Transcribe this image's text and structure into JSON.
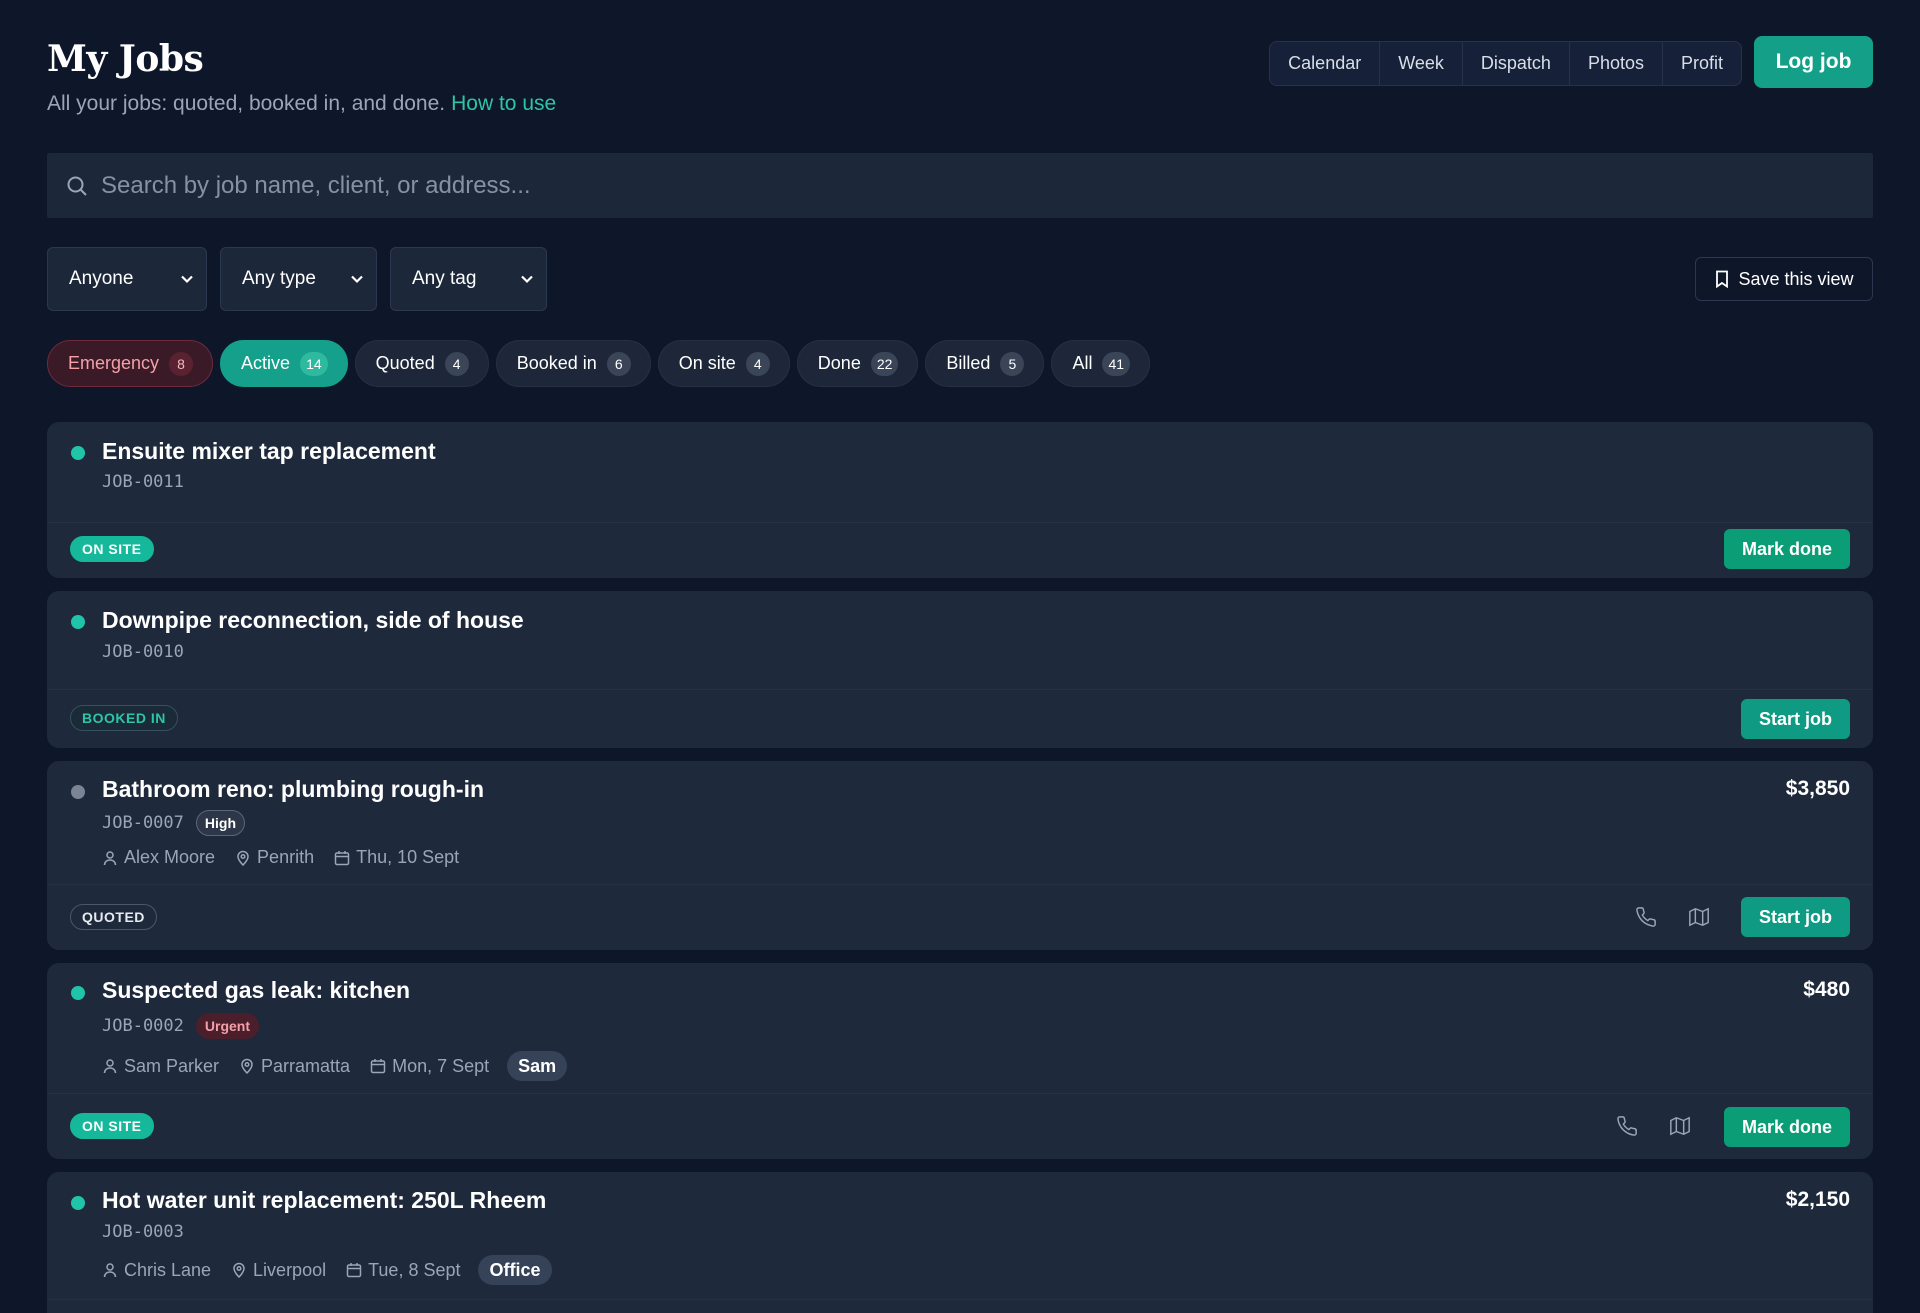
{
  "header": {
    "title": "My Jobs",
    "subtitle": "All your jobs: quoted, booked in, and done.",
    "help_link": "How to use",
    "nav": [
      "Calendar",
      "Week",
      "Dispatch",
      "Photos",
      "Profit"
    ],
    "log_button": "Log job"
  },
  "search": {
    "placeholder": "Search by job name, client, or address..."
  },
  "filters": {
    "assignee": "Anyone",
    "type": "Any type",
    "tag": "Any tag",
    "save_view": "Save this view"
  },
  "pills": [
    {
      "label": "Emergency",
      "count": "8"
    },
    {
      "label": "Active",
      "count": "14"
    },
    {
      "label": "Quoted",
      "count": "4"
    },
    {
      "label": "Booked in",
      "count": "6"
    },
    {
      "label": "On site",
      "count": "4"
    },
    {
      "label": "Done",
      "count": "22"
    },
    {
      "label": "Billed",
      "count": "5"
    },
    {
      "label": "All",
      "count": "41"
    }
  ],
  "jobs": [
    {
      "title": "Ensuite mixer tap replacement",
      "id": "JOB-0011",
      "status": "ON SITE",
      "action": "Mark done"
    },
    {
      "title": "Downpipe reconnection, side of house",
      "id": "JOB-0010",
      "status": "BOOKED IN",
      "action": "Start job"
    },
    {
      "title": "Bathroom reno: plumbing rough-in",
      "id": "JOB-0007",
      "priority": "High",
      "amount": "$3,850",
      "client": "Alex Moore",
      "location": "Penrith",
      "date": "Thu, 10 Sept",
      "status": "QUOTED",
      "action": "Start job"
    },
    {
      "title": "Suspected gas leak: kitchen",
      "id": "JOB-0002",
      "priority": "Urgent",
      "amount": "$480",
      "client": "Sam Parker",
      "location": "Parramatta",
      "date": "Mon, 7 Sept",
      "tag": "Sam",
      "status": "ON SITE",
      "action": "Mark done"
    },
    {
      "title": "Hot water unit replacement: 250L Rheem",
      "id": "JOB-0003",
      "amount": "$2,150",
      "client": "Chris Lane",
      "location": "Liverpool",
      "date": "Tue, 8 Sept",
      "tag": "Office"
    }
  ],
  "colors": {
    "accent": "#14a088",
    "background": "#0e1629",
    "card": "#1e293b",
    "emergency": "#f4a0a8"
  }
}
